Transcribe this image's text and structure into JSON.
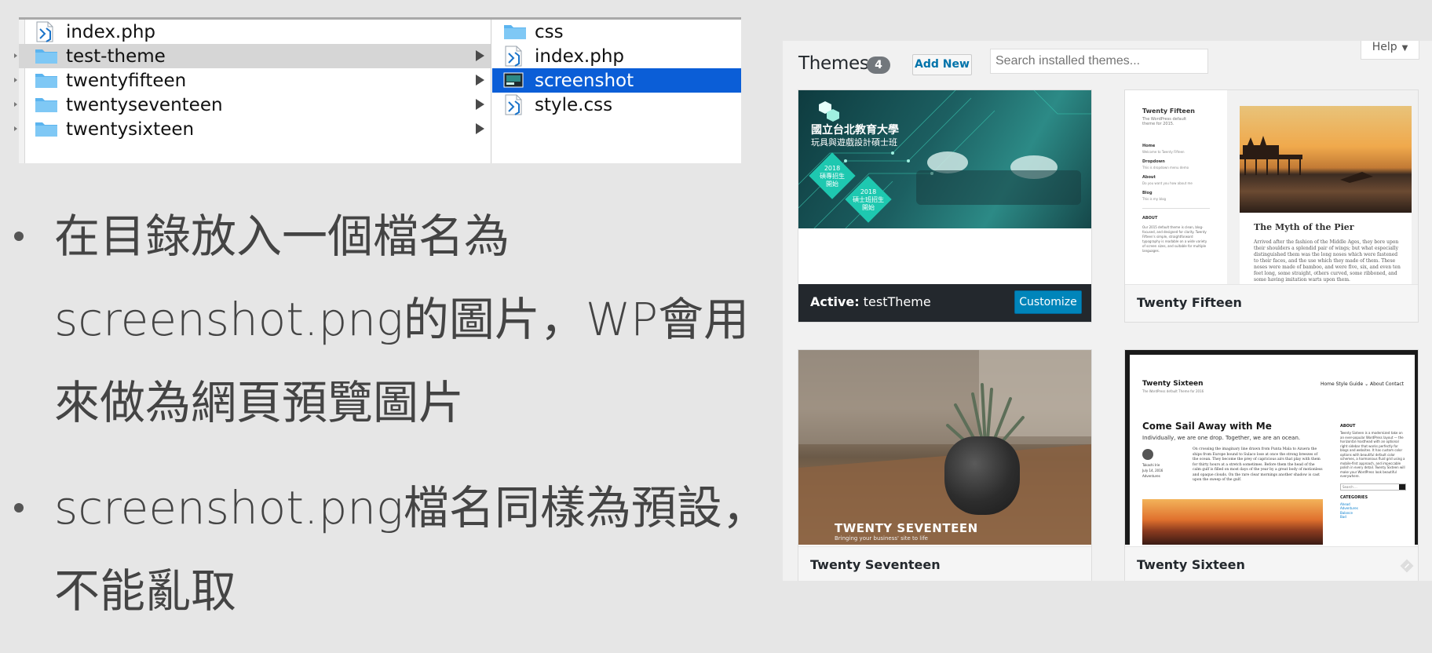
{
  "finder": {
    "col1": [
      {
        "name": "index.php",
        "type": "php"
      },
      {
        "name": "test-theme",
        "type": "folder",
        "selected": true
      },
      {
        "name": "twentyfifteen",
        "type": "folder"
      },
      {
        "name": "twentyseventeen",
        "type": "folder"
      },
      {
        "name": "twentysixteen",
        "type": "folder"
      }
    ],
    "col2": [
      {
        "name": "css",
        "type": "folder"
      },
      {
        "name": "index.php",
        "type": "php"
      },
      {
        "name": "screenshot",
        "type": "image",
        "selected": true
      },
      {
        "name": "style.css",
        "type": "css"
      }
    ],
    "selection_color": "#0b5ed7",
    "folder_color": "#5bb4ef"
  },
  "bullets": [
    {
      "lines": [
        "在目錄放入一個檔名為",
        "screenshot.png的圖片，WP會用",
        "來做為網頁預覽圖片"
      ]
    },
    {
      "lines": [
        "screenshot.png檔名同樣為預設，",
        "不能亂取"
      ]
    }
  ],
  "wp": {
    "title": "Themes",
    "count": "4",
    "add_new": "Add New",
    "search_placeholder": "Search installed themes...",
    "help": "Help",
    "themes": {
      "active": {
        "label": "Active:",
        "name": "testTheme",
        "customize": "Customize",
        "shot": {
          "title": "國立台北教育大學",
          "subtitle": "玩具與遊戲設計碩士班",
          "badge1": [
            "2018",
            "碩專招生",
            "開始"
          ],
          "badge2": [
            "2018",
            "碩士班招生",
            "開始"
          ]
        }
      },
      "twenty_fifteen": {
        "name": "Twenty Fifteen",
        "shot": {
          "site": "Twenty Fifteen",
          "tagline": "The WordPress default theme for 2015.",
          "nav": [
            "Home",
            "Welcome to Twenty Fifteen",
            "Dropdown",
            "This is dropdown menu demo",
            "About",
            "Do you want you how about me",
            "Blog",
            "This is my blog"
          ],
          "about_heading": "ABOUT",
          "about_text": "Our 2015 default theme is clean, blog-focused, and designed for clarity. Twenty Fifteen's simple, straightforward typography is readable on a wide variety of screen sizes, and suitable for multiple languages.",
          "post_title": "The Myth of the Pier",
          "post_text": "Arrived after the fashion of the Middle Ages, they bore upon their shoulders a splendid pair of wings; but what especially distinguished them was the long noses which were fastened to their faces, and the use which they made of them. These noses were made of bamboo, and were five, six, and even ten feet long, some straight, others curved, some ribboned, and some having imitation warts upon them."
        }
      },
      "twenty_seventeen": {
        "name": "Twenty Seventeen",
        "shot": {
          "title": "TWENTY SEVENTEEN",
          "subtitle": "Bringing your business' site to life"
        }
      },
      "twenty_sixteen": {
        "name": "Twenty Sixteen",
        "shot": {
          "site": "Twenty Sixteen",
          "tagline": "The WordPress default Theme for 2016",
          "nav": "Home   Style Guide ⌄   About   Contact",
          "post_title": "Come Sail Away with Me",
          "post_lede": "Individually, we are one drop. Together, we are an ocean.",
          "meta": [
            "Takashi Irie",
            "July 14, 2016",
            "Adventures"
          ],
          "post_text": "On crossing the imaginary line drawn from Punta Mala to Azuera the ships from Europe bound to Sulaco lose at once the strong breezes of the ocean. They become the prey of capricious airs that play with them for thirty hours at a stretch sometimes. Before them the head of the calm gulf is filled on most days of the year by a great body of motionless and opaque clouds. On the rare clear mornings another shadow is cast upon the sweep of the gulf.",
          "aside_about": "ABOUT",
          "aside_text": "Twenty Sixteen is a modernized take on an ever-popular WordPress layout — the horizontal masthead with an optional right sidebar that works perfectly for blogs and websites. It has custom color options with beautiful default color schemes, a harmonious fluid grid using a mobile-first approach, and impeccable polish in every detail. Twenty Sixteen will make your WordPress look beautiful everywhere.",
          "aside_search": "Search ...",
          "aside_cat": "CATEGORIES",
          "categories": [
            "Ahead",
            "Adventures",
            "Balance",
            "Bad"
          ]
        }
      }
    }
  }
}
